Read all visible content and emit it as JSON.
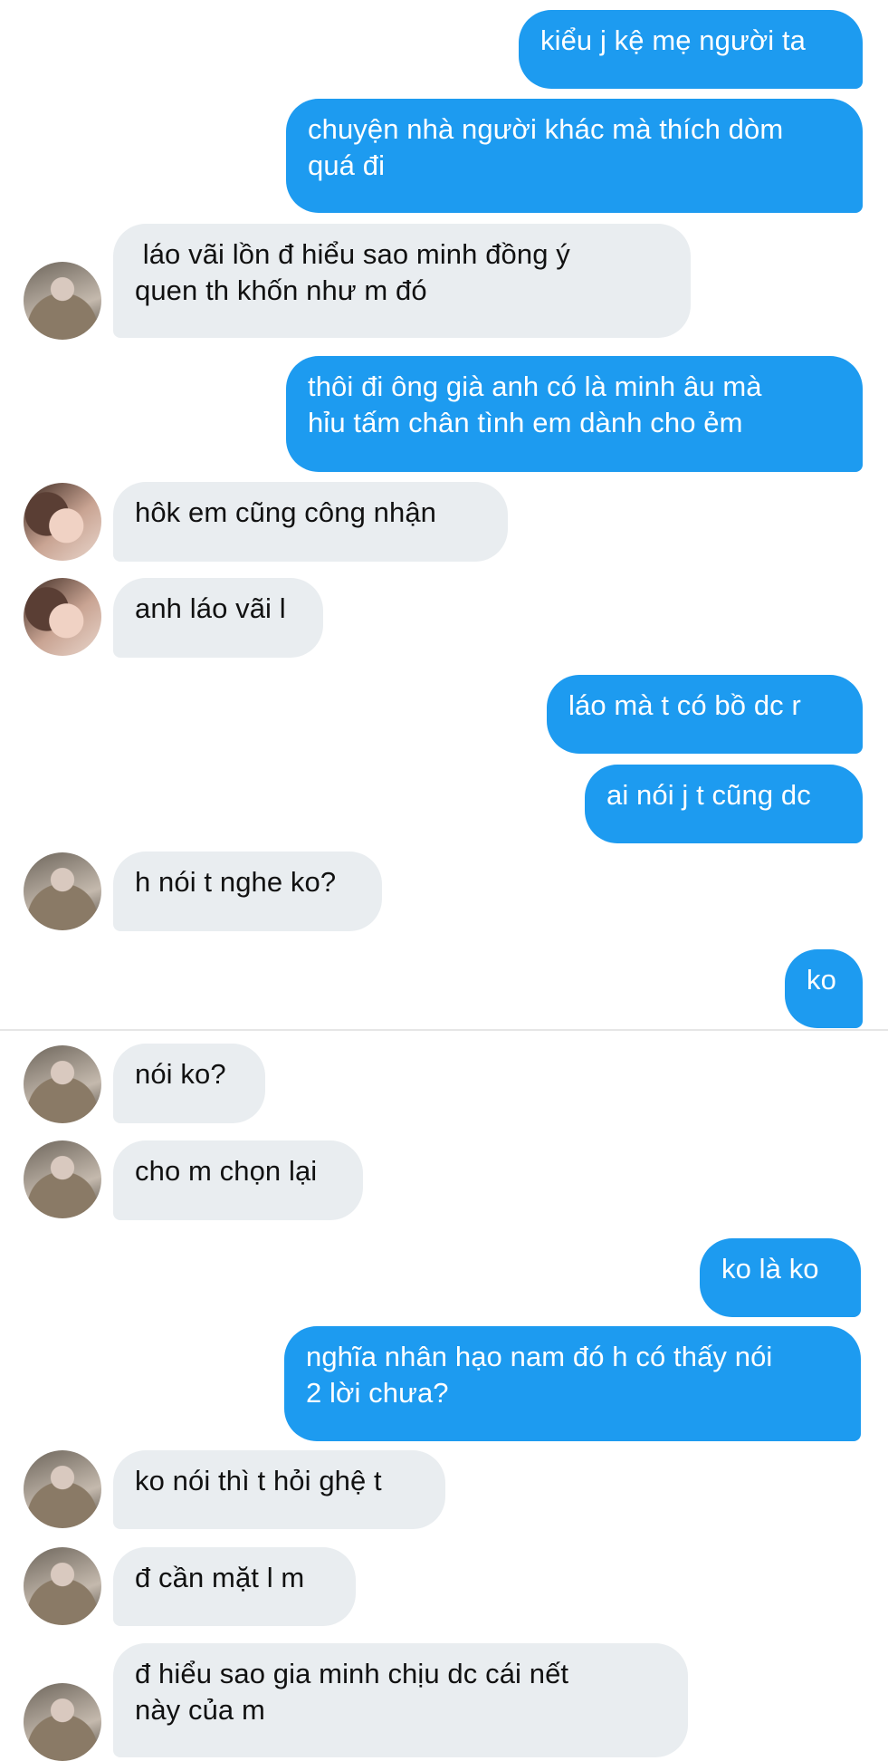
{
  "colors": {
    "outgoing_bubble": "#1d9bf0",
    "incoming_bubble": "#e9edf0",
    "outgoing_text": "#ffffff",
    "incoming_text": "#111111"
  },
  "messages": [
    {
      "direction": "out",
      "text": "kiểu j kệ mẹ người ta"
    },
    {
      "direction": "out",
      "text": "chuyện nhà người khác mà thích dòm\nquá đi"
    },
    {
      "direction": "in",
      "avatar": "avatar-1",
      "text": " láo vãi lồn đ hiểu sao minh đồng ý\nquen th khốn như m đó"
    },
    {
      "direction": "out",
      "text": "thôi đi ông già anh có là minh âu mà\nhỉu tấm chân tình em dành cho ẻm"
    },
    {
      "direction": "in",
      "avatar": "avatar-2",
      "text": "hôk em cũng công nhận"
    },
    {
      "direction": "in",
      "avatar": "avatar-2",
      "text": "anh láo vãi l"
    },
    {
      "direction": "out",
      "text": "láo mà t có bồ dc r"
    },
    {
      "direction": "out",
      "text": "ai nói j t cũng dc"
    },
    {
      "direction": "in",
      "avatar": "avatar-1",
      "text": "h nói t nghe ko?"
    },
    {
      "direction": "out",
      "text": "ko"
    },
    {
      "direction": "in",
      "avatar": "avatar-1",
      "text": "nói ko?"
    },
    {
      "direction": "in",
      "avatar": "avatar-1",
      "text": "cho m chọn lại"
    },
    {
      "direction": "out",
      "text": "ko là ko"
    },
    {
      "direction": "out",
      "text": "nghĩa nhân hạo nam đó h có thấy nói\n2 lời chưa?"
    },
    {
      "direction": "in",
      "avatar": "avatar-1",
      "text": "ko nói thì t hỏi ghệ t"
    },
    {
      "direction": "in",
      "avatar": "avatar-1",
      "text": "đ cần mặt l m"
    },
    {
      "direction": "in",
      "avatar": "avatar-1",
      "text": "đ hiểu sao gia minh chịu dc cái nết\nnày của m"
    }
  ]
}
